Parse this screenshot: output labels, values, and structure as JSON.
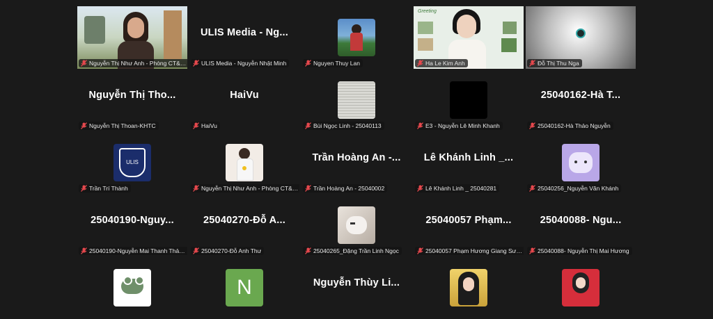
{
  "participants": [
    {
      "display": "",
      "label": "Nguyễn Thị Như Anh - Phòng CT&CT...",
      "kind": "video-woman"
    },
    {
      "display": "ULIS Media - Ng...",
      "label": "ULIS Media - Nguyễn Nhật Minh",
      "kind": "name"
    },
    {
      "display": "",
      "label": "Nguyen Thuy Lan",
      "kind": "avatar-photo"
    },
    {
      "display": "",
      "label": "Ha Le Kim Anh",
      "kind": "video-share",
      "speaking": true
    },
    {
      "display": "",
      "label": "Đỗ Thị Thu Nga",
      "kind": "video-gray"
    },
    {
      "display": "Nguyễn Thị Tho...",
      "label": "Nguyễn Thị Thoan-KHTC",
      "kind": "name"
    },
    {
      "display": "HaiVu",
      "label": "HaiVu",
      "kind": "name"
    },
    {
      "display": "",
      "label": "Bùi Ngọc Linh - 25040113",
      "kind": "avatar-paper"
    },
    {
      "display": "",
      "label": "E3 - Nguyễn Lê Minh Khanh",
      "kind": "avatar-black"
    },
    {
      "display": "25040162-Hà  T...",
      "label": "25040162-Hà Thảo Nguyễn",
      "kind": "name"
    },
    {
      "display": "",
      "label": "Trần Trí Thành",
      "kind": "avatar-ulis"
    },
    {
      "display": "",
      "label": "Nguyễn Thị Như Anh - Phòng CT&CT HS...",
      "kind": "avatar-photo-light"
    },
    {
      "display": "Trần Hoàng An -...",
      "label": "Trần Hoàng An - 25040002",
      "kind": "name"
    },
    {
      "display": "Lê Khánh Linh _...",
      "label": "Lê Khánh Linh _ 25040281",
      "kind": "name"
    },
    {
      "display": "",
      "label": "25040256_Nguyễn Văn Khánh",
      "kind": "avatar-cat"
    },
    {
      "display": "25040190-Nguy...",
      "label": "25040190-Nguyễn Mai Thanh Thảo-...",
      "kind": "name"
    },
    {
      "display": "25040270-Đỗ  A...",
      "label": "25040270-Đỗ Anh Thư",
      "kind": "name"
    },
    {
      "display": "",
      "label": "25040265_Đặng Trần Linh Ngọc",
      "kind": "avatar-cat-photo"
    },
    {
      "display": "25040057  Phạm...",
      "label": "25040057 Phạm Hương Giang Sư ph...",
      "kind": "name"
    },
    {
      "display": "25040088-  Ngu...",
      "label": "25040088- Nguyễn Thị Mai Hương",
      "kind": "name"
    },
    {
      "display": "",
      "label": "",
      "kind": "avatar-frog"
    },
    {
      "display": "",
      "label": "",
      "kind": "avatar-n",
      "letter": "N"
    },
    {
      "display": "Nguyễn Thùy Li...",
      "label": "",
      "kind": "name"
    },
    {
      "display": "",
      "label": "",
      "kind": "avatar-girl"
    },
    {
      "display": "",
      "label": "",
      "kind": "avatar-girl2"
    }
  ],
  "colors": {
    "background": "#1a1a1a",
    "active_speaker": "#23d959",
    "muted_icon": "#e5484d"
  }
}
